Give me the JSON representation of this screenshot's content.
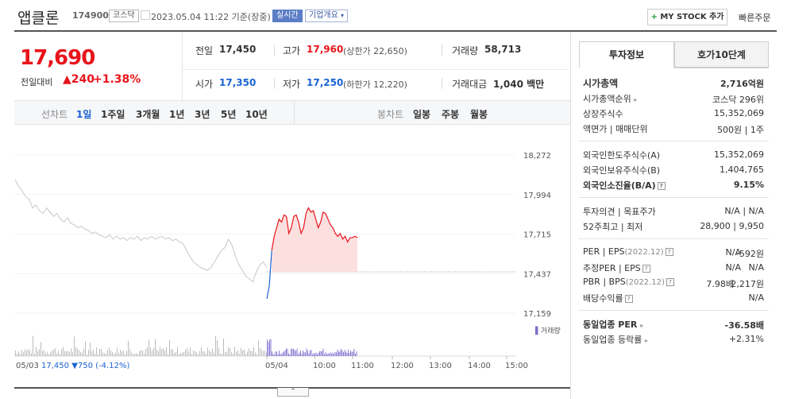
{
  "header": {
    "title": "앱클론",
    "code": "174900",
    "market": "코스닥",
    "datetime": "2023.05.04 11:22 기준(장중)",
    "live_badge": "실시간",
    "overview_badge": "기업개요",
    "mystock_plus": "+",
    "mystock_label": "MY STOCK 추가",
    "fast_order": "빠른주문"
  },
  "quote": {
    "price": "17,690",
    "change_label": "전일대비",
    "change_arrow": "▲",
    "change_value": "240",
    "change_pct": "+1.38%",
    "prev_close_label": "전일",
    "prev_close": "17,450",
    "high_label": "고가",
    "high": "17,960",
    "upper_limit": "(상한가 22,650)",
    "volume_label": "거래량",
    "volume": "58,713",
    "open_label": "시가",
    "open": "17,350",
    "low_label": "저가",
    "low": "17,250",
    "lower_limit": "(하한가 12,220)",
    "amount_label": "거래대금",
    "amount": "1,040 백만"
  },
  "tabs": {
    "line_chart_label": "선차트",
    "periods": [
      "1일",
      "1주일",
      "3개월",
      "1년",
      "3년",
      "5년",
      "10년"
    ],
    "candle_label": "봉차트",
    "candle_periods": [
      "일봉",
      "주봉",
      "월봉"
    ]
  },
  "chart_data": {
    "type": "line",
    "y_ticks": [
      "18,272",
      "17,994",
      "17,715",
      "17,437",
      "17,159"
    ],
    "ylim": [
      17159,
      18272
    ],
    "x_ticks": [
      "05/04",
      "10:00",
      "11:00",
      "12:00",
      "13:00",
      "14:00",
      "15:00"
    ],
    "volume_label": "거래량",
    "prev_day_label": "05/03",
    "prev_day_close": "17,450",
    "prev_day_change": "▼750",
    "prev_day_pct": "(-4.12%)",
    "baseline": 17450,
    "prev_series": [
      18100,
      18050,
      18020,
      17980,
      17960,
      17900,
      17920,
      17880,
      17860,
      17900,
      17870,
      17840,
      17860,
      17820,
      17800,
      17830,
      17790,
      17780,
      17760,
      17770,
      17750,
      17740,
      17720,
      17730,
      17710,
      17700,
      17690,
      17710,
      17680,
      17700,
      17680,
      17690,
      17670,
      17690,
      17680,
      17700,
      17670,
      17690,
      17680,
      17700,
      17680,
      17690,
      17700,
      17680,
      17690,
      17670,
      17680,
      17660,
      17650,
      17600,
      17560,
      17520,
      17500,
      17480,
      17470,
      17460,
      17480,
      17520,
      17560,
      17600,
      17620,
      17680,
      17640,
      17560,
      17500,
      17460,
      17420,
      17400,
      17380,
      17450,
      17500,
      17520,
      17480
    ],
    "today_series": [
      17260,
      17350,
      17600,
      17700,
      17760,
      17820,
      17800,
      17850,
      17840,
      17720,
      17760,
      17840,
      17850,
      17800,
      17720,
      17760,
      17860,
      17900,
      17870,
      17880,
      17820,
      17760,
      17800,
      17870,
      17860,
      17820,
      17780,
      17760,
      17720,
      17700,
      17720,
      17680,
      17700,
      17660,
      17690,
      17690,
      17700,
      17690
    ]
  },
  "info": {
    "tab_active": "투자정보",
    "tab_inactive": "호가10단계",
    "market_cap_label": "시가총액",
    "market_cap": "2,716억원",
    "market_cap_rank_label": "시가총액순위",
    "market_cap_rank": "코스닥 296위",
    "shares_label": "상장주식수",
    "shares": "15,352,069",
    "par_label": "액면가 | 매매단위",
    "par": "500원 | 1주",
    "foreign_limit_label": "외국인한도주식수(A)",
    "foreign_limit": "15,352,069",
    "foreign_hold_label": "외국인보유주식수(B)",
    "foreign_hold": "1,404,765",
    "foreign_rate_label": "외국인소진율(B/A)",
    "foreign_rate": "9.15%",
    "opinion_label": "투자의견 | 목표주가",
    "opinion": "N/A | N/A",
    "week52_label": "52주최고 | 최저",
    "week52": "28,900 | 9,950",
    "per_eps_label": "PER | EPS",
    "per_eps_date": "(2022.12)",
    "per": "N/A",
    "eps": "-592원",
    "est_label": "추정PER | EPS",
    "est_per": "N/A",
    "est_eps": "N/A",
    "pbr_bps_label": "PBR | BPS",
    "pbr_bps_date": "(2022.12)",
    "pbr": "7.98배",
    "bps": "2,217원",
    "div_label": "배당수익률",
    "div": "N/A",
    "sector_per_label": "동일업종 PER",
    "sector_per": "-36.58배",
    "sector_chg_label": "동일업종 등락률",
    "sector_chg": "+2.31%"
  }
}
